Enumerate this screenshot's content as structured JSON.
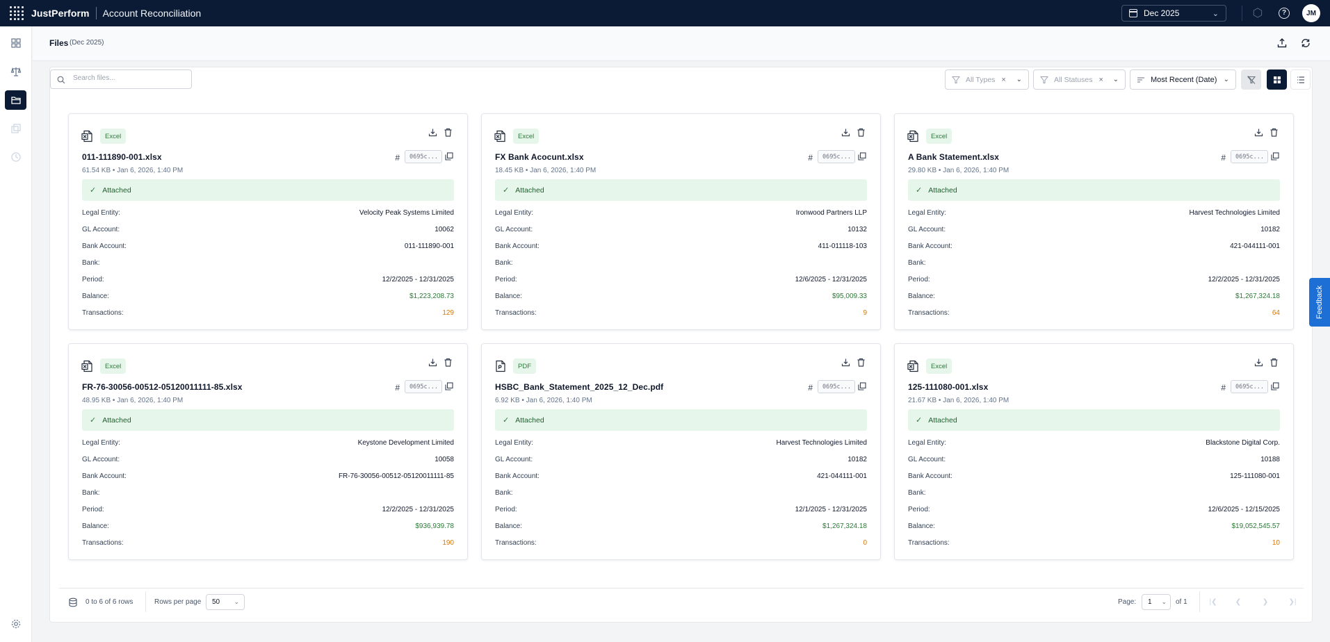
{
  "app": {
    "brand": "JustPerform",
    "title": "Account Reconciliation",
    "period": "Dec 2025",
    "avatar": "JM"
  },
  "page": {
    "title": "Files",
    "subtitle": "(Dec 2025)"
  },
  "toolbar": {
    "search_placeholder": "Search files...",
    "type_filter": "All Types",
    "status_filter": "All Statuses",
    "sort": "Most Recent (Date)"
  },
  "labels": {
    "legal_entity": "Legal Entity:",
    "gl_account": "GL Account:",
    "bank_account": "Bank Account:",
    "bank": "Bank:",
    "period": "Period:",
    "balance": "Balance:",
    "transactions": "Transactions:",
    "hash": "#"
  },
  "files": [
    {
      "name": "011-111890-001.xlsx",
      "type": "Excel",
      "meta": "61.54 KB • Jan 6, 2026, 1:40 PM",
      "hash": "0695c...",
      "status": "Attached",
      "legal_entity": "Velocity Peak Systems Limited",
      "gl_account": "10062",
      "bank_account": "011-111890-001",
      "bank": "",
      "period": "12/2/2025 - 12/31/2025",
      "balance": "$1,223,208.73",
      "transactions": "129"
    },
    {
      "name": "FX Bank Acocunt.xlsx",
      "type": "Excel",
      "meta": "18.45 KB • Jan 6, 2026, 1:40 PM",
      "hash": "0695c...",
      "status": "Attached",
      "legal_entity": "Ironwood Partners LLP",
      "gl_account": "10132",
      "bank_account": "411-011118-103",
      "bank": "",
      "period": "12/6/2025 - 12/31/2025",
      "balance": "$95,009.33",
      "transactions": "9"
    },
    {
      "name": "A Bank Statement.xlsx",
      "type": "Excel",
      "meta": "29.80 KB • Jan 6, 2026, 1:40 PM",
      "hash": "0695c...",
      "status": "Attached",
      "legal_entity": "Harvest Technologies Limited",
      "gl_account": "10182",
      "bank_account": "421-044111-001",
      "bank": "",
      "period": "12/2/2025 - 12/31/2025",
      "balance": "$1,267,324.18",
      "transactions": "64"
    },
    {
      "name": "FR-76-30056-00512-05120011111-85.xlsx",
      "type": "Excel",
      "meta": "48.95 KB • Jan 6, 2026, 1:40 PM",
      "hash": "0695c...",
      "status": "Attached",
      "legal_entity": "Keystone Development Limited",
      "gl_account": "10058",
      "bank_account": "FR-76-30056-00512-05120011111-85",
      "bank": "",
      "period": "12/2/2025 - 12/31/2025",
      "balance": "$936,939.78",
      "transactions": "190"
    },
    {
      "name": "HSBC_Bank_Statement_2025_12_Dec.pdf",
      "type": "PDF",
      "meta": "6.92 KB • Jan 6, 2026, 1:40 PM",
      "hash": "0695c...",
      "status": "Attached",
      "legal_entity": "Harvest Technologies Limited",
      "gl_account": "10182",
      "bank_account": "421-044111-001",
      "bank": "",
      "period": "12/1/2025 - 12/31/2025",
      "balance": "$1,267,324.18",
      "transactions": "0"
    },
    {
      "name": "125-111080-001.xlsx",
      "type": "Excel",
      "meta": "21.67 KB • Jan 6, 2026, 1:40 PM",
      "hash": "0695c...",
      "status": "Attached",
      "legal_entity": "Blackstone Digital Corp.",
      "gl_account": "10188",
      "bank_account": "125-111080-001",
      "bank": "",
      "period": "12/6/2025 - 12/15/2025",
      "balance": "$19,052,545.57",
      "transactions": "10"
    }
  ],
  "footer": {
    "rows_text": "0 to 6 of 6 rows",
    "rows_per_page_label": "Rows per page",
    "rows_per_page": "50",
    "page_label": "Page:",
    "page": "1",
    "of_text": "of 1"
  },
  "feedback": "Feedback",
  "colors": {
    "topbar": "#0b1b36",
    "badge_bg": "#e7f6ea",
    "balance": "#2b7a36",
    "transactions": "#d97706",
    "feedback": "#1d6fd6"
  }
}
